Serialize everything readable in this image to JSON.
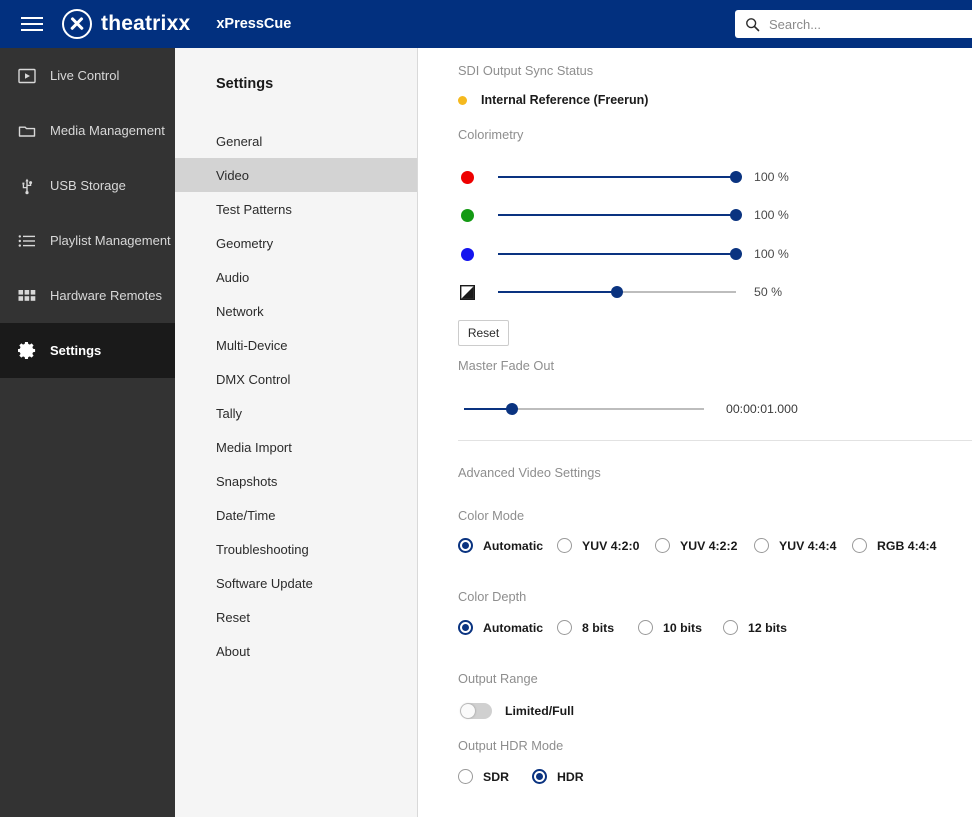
{
  "header": {
    "brand_name": "theatrixx",
    "app_name": "xPressCue",
    "menu_icon": "hamburger-icon",
    "logo_icon": "theatrixx-x-logo-icon",
    "search": {
      "icon": "search-icon",
      "placeholder": "Search...",
      "value": ""
    },
    "background_color": "#02307f"
  },
  "sidebar": {
    "background_color": "#333333",
    "active_background_color": "#1a1a1a",
    "items": [
      {
        "label": "Live Control",
        "icon": "live-control-icon",
        "active": false
      },
      {
        "label": "Media Management",
        "icon": "folder-icon",
        "active": false
      },
      {
        "label": "USB Storage",
        "icon": "usb-icon",
        "active": false
      },
      {
        "label": "Playlist Management",
        "icon": "list-icon",
        "active": false
      },
      {
        "label": "Hardware Remotes",
        "icon": "grid-icon",
        "active": false
      },
      {
        "label": "Settings",
        "icon": "gear-icon",
        "active": true
      }
    ]
  },
  "submenu": {
    "title": "Settings",
    "background_color": "#f5f5f5",
    "active_background_color": "#d3d3d3",
    "items": [
      {
        "label": "General",
        "active": false
      },
      {
        "label": "Video",
        "active": true
      },
      {
        "label": "Test Patterns",
        "active": false
      },
      {
        "label": "Geometry",
        "active": false
      },
      {
        "label": "Audio",
        "active": false
      },
      {
        "label": "Network",
        "active": false
      },
      {
        "label": "Multi-Device",
        "active": false
      },
      {
        "label": "DMX Control",
        "active": false
      },
      {
        "label": "Tally",
        "active": false
      },
      {
        "label": "Media Import",
        "active": false
      },
      {
        "label": "Snapshots",
        "active": false
      },
      {
        "label": "Date/Time",
        "active": false
      },
      {
        "label": "Troubleshooting",
        "active": false
      },
      {
        "label": "Software Update",
        "active": false
      },
      {
        "label": "Reset",
        "active": false
      },
      {
        "label": "About",
        "active": false
      }
    ]
  },
  "main": {
    "sync_status": {
      "label": "SDI Output Sync Status",
      "value": "Internal Reference (Freerun)",
      "dot_color": "#f5b91e"
    },
    "colorimetry": {
      "label": "Colorimetry",
      "sliders": [
        {
          "icon": "red-dot-icon",
          "color": "#ee0000",
          "value": 100,
          "display": "100 %"
        },
        {
          "icon": "green-dot-icon",
          "color": "#149a14",
          "value": 100,
          "display": "100 %"
        },
        {
          "icon": "blue-dot-icon",
          "color": "#1414ee",
          "value": 100,
          "display": "100 %"
        },
        {
          "icon": "contrast-icon",
          "color": "#1a1a1a",
          "value": 50,
          "display": "50 %"
        }
      ],
      "reset_label": "Reset"
    },
    "master_fade_out": {
      "label": "Master Fade Out",
      "value": 20,
      "display": "00:00:01.000"
    },
    "advanced_video_settings": {
      "label": "Advanced Video Settings"
    },
    "color_mode": {
      "label": "Color Mode",
      "options": [
        {
          "label": "Automatic",
          "selected": true
        },
        {
          "label": "YUV 4:2:0",
          "selected": false
        },
        {
          "label": "YUV 4:2:2",
          "selected": false
        },
        {
          "label": "YUV 4:4:4",
          "selected": false
        },
        {
          "label": "RGB 4:4:4",
          "selected": false
        }
      ]
    },
    "color_depth": {
      "label": "Color Depth",
      "options": [
        {
          "label": "Automatic",
          "selected": true
        },
        {
          "label": "8 bits",
          "selected": false
        },
        {
          "label": "10 bits",
          "selected": false
        },
        {
          "label": "12 bits",
          "selected": false
        }
      ]
    },
    "output_range": {
      "label": "Output Range",
      "toggle_label": "Limited/Full",
      "enabled": false
    },
    "output_hdr_mode": {
      "label": "Output HDR Mode",
      "options": [
        {
          "label": "SDR",
          "selected": false
        },
        {
          "label": "HDR",
          "selected": true
        }
      ]
    }
  },
  "theme": {
    "accent": "#0a3380",
    "brand_blue": "#02307f"
  }
}
